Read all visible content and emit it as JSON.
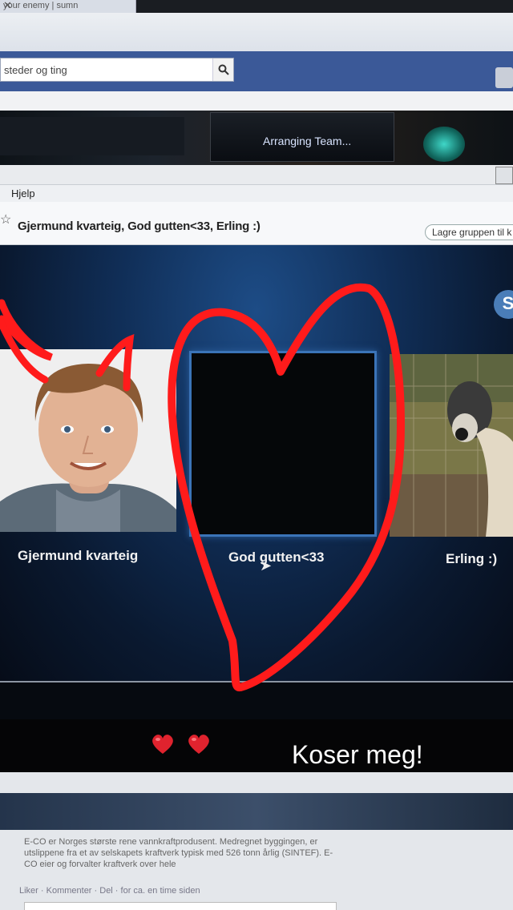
{
  "browser": {
    "tab_title": "your enemy | sumn",
    "tab_close": "✕",
    "search_placeholder": "steder og ting",
    "search_icon": "search-icon"
  },
  "game": {
    "status": "Arranging Team..."
  },
  "skype": {
    "menu": {
      "help": "Hjelp"
    },
    "conversation_title": "Gjermund kvarteig, God gutten<33, Erling :)",
    "save_group_button": "Lagre gruppen til k",
    "logo_letter": "S",
    "participants": [
      {
        "name": "Gjermund kvarteig"
      },
      {
        "name": "God gutten<33"
      },
      {
        "name": "Erling :)"
      }
    ]
  },
  "caption": {
    "text": "Koser meg!",
    "emoji": [
      "red-heart",
      "red-heart"
    ]
  },
  "facebook_post": {
    "text": "E-CO er Norges største rene vannkraftprodusent. Medregnet byggingen, er utslippene fra et av selskapets kraftverk typisk med 526 tonn årlig (SINTEF). E-CO eier og forvalter kraftverk over hele",
    "actions": "Liker · Kommenter · Del · for ca. en time siden"
  },
  "colors": {
    "facebook_blue": "#3b5998",
    "skype_bg": "#102e57",
    "tile_border": "#3b74b8",
    "drawing_red": "#ff1b1b"
  }
}
